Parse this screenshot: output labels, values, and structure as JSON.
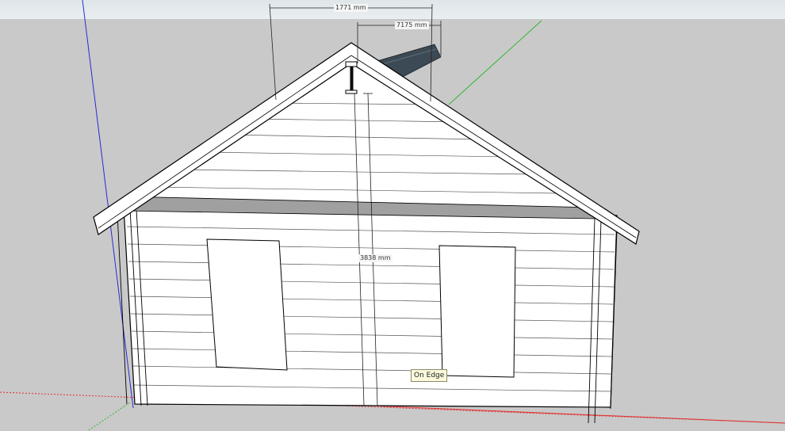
{
  "viewport": {
    "sky_color": "#e6ecef",
    "ground_color": "#c9c9c9",
    "axes": {
      "blue_axis": "#2a2ad0",
      "red_axis": "#e03030",
      "green_axis": "#2fb82f"
    }
  },
  "dimensions": {
    "width_top": "1771 mm",
    "width_offset": "7175 mm",
    "height": "3838 mm"
  },
  "inference_tooltip": "On Edge",
  "model": {
    "siding_color": "#ffffff",
    "trim_color": "#a0a0a0",
    "beam_color": "#3c4a55",
    "edge_color": "#000000"
  }
}
